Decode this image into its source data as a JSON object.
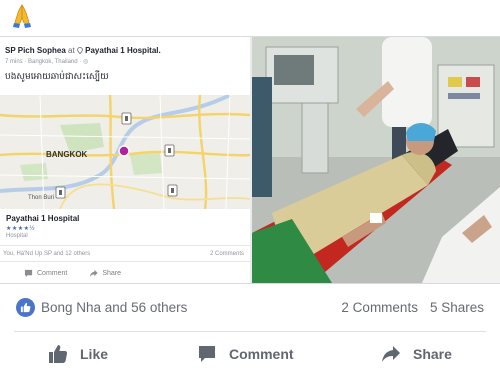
{
  "checkin_post": {
    "author": "SP Pich Sophea",
    "at_word": "at",
    "place": "Payathai 1 Hospital.",
    "meta": "7 mins · Bangkok, Thailand · ",
    "khmer_text": "បងសូមអោយឆាប់ជាសះស្បើយ",
    "map_city": "BANGKOK",
    "map_city2": "Thon Buri",
    "place_name": "Payathai 1 Hospital",
    "rating": "★★★★½",
    "category": "Hospital",
    "likes_text": "You, Hà'Nd Up SP and 12 others",
    "comments_text": "2 Comments",
    "comment_label": "Comment",
    "share_label": "Share"
  },
  "reactions": {
    "text": "Bong Nha and 56 others",
    "comments": "2 Comments",
    "shares": "5 Shares"
  },
  "actions": {
    "like": "Like",
    "comment": "Comment",
    "share": "Share"
  },
  "colors": {
    "facebook_blue": "#4a76c9",
    "action_gray": "#616770"
  },
  "icons": [
    "praying-hands-icon",
    "location-pin-icon",
    "like-thumb-icon",
    "comment-bubble-icon",
    "share-arrow-icon",
    "hospital-map-marker-icon"
  ]
}
